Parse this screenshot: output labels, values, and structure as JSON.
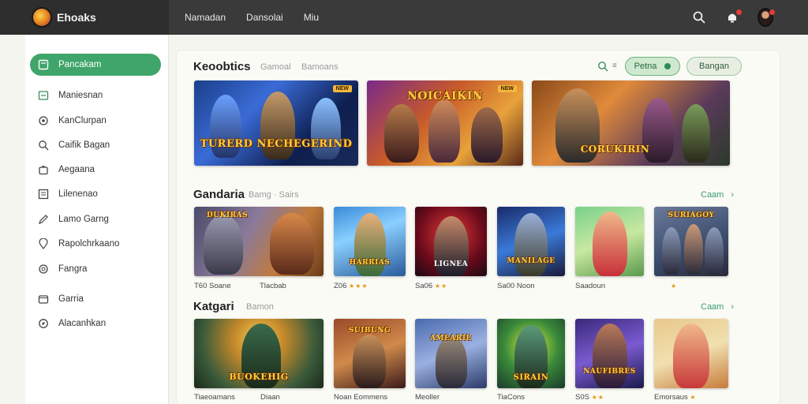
{
  "header": {
    "brand": "Ehoaks",
    "nav": [
      "Namadan",
      "Dansolai",
      "Miu"
    ]
  },
  "sidebar": {
    "items": [
      {
        "label": "Pancakam",
        "icon": "square-icon",
        "active": true
      },
      {
        "label": "Maniesnan",
        "icon": "image-icon",
        "active": false
      },
      {
        "label": "KanClurpan",
        "icon": "gear-icon",
        "active": false
      },
      {
        "label": "Caifik Bagan",
        "icon": "search-icon",
        "active": false
      },
      {
        "label": "Aegaana",
        "icon": "bag-icon",
        "active": false
      },
      {
        "label": "Lilenenao",
        "icon": "list-icon",
        "active": false
      },
      {
        "label": "Lamo Garng",
        "icon": "pencil-icon",
        "active": false
      },
      {
        "label": "Rapolchrkaano",
        "icon": "location-icon",
        "active": false
      },
      {
        "label": "Fangra",
        "icon": "settings-icon",
        "active": false
      },
      {
        "label": "Garria",
        "icon": "folder-icon",
        "active": false
      },
      {
        "label": "Alacanhkan",
        "icon": "compass-icon",
        "active": false
      }
    ]
  },
  "featured": {
    "title": "Keoobtics",
    "tabs": [
      "Gamoal",
      "Bamoans"
    ],
    "search_hint": "≡",
    "filter_chip": "Petna",
    "action_chip": "Bangan",
    "cards": [
      {
        "title": "TURERD NECHEGERIND",
        "tag": "NEW"
      },
      {
        "title": "NOICAIKIN",
        "tag": "NEW"
      },
      {
        "title": "CORUKIRIN",
        "tag": ""
      }
    ]
  },
  "section_two": {
    "title": "Gandaria",
    "sub": "Bamg · Sairs",
    "link": "Caam",
    "items": [
      {
        "title": "DUKIRAS",
        "caption": "T60 Soane",
        "stars": ""
      },
      {
        "title": "HARRIAS",
        "caption": "Z06",
        "stars": "★★★"
      },
      {
        "title": "LIGNEA",
        "caption": "Sa06",
        "stars": "★★"
      },
      {
        "title": "MANILAGE",
        "caption": "Sa00 Noon",
        "stars": ""
      },
      {
        "title": "",
        "caption": "Saadoun",
        "stars": ""
      },
      {
        "title": "SURIAGOY",
        "caption": "",
        "stars": "★"
      }
    ]
  },
  "section_three": {
    "title": "Katgari",
    "sub": "Bamon",
    "link": "Caam",
    "items": [
      {
        "title": "BUOKEHIG",
        "caption": "Tiaeoamans",
        "stars": ""
      },
      {
        "title": "SUIBUNG",
        "caption": "Noan Eommens",
        "stars": ""
      },
      {
        "title": "AMEARIE",
        "caption": "Meoller",
        "stars": ""
      },
      {
        "title": "SIRAIN",
        "caption": "TiaCons",
        "stars": ""
      },
      {
        "title": "NAUFIBRES",
        "caption": "S0S",
        "stars": "★★"
      },
      {
        "title": "",
        "caption": "Emorsaus",
        "stars": "★"
      }
    ]
  },
  "colors": {
    "accent_green": "#3fa56a",
    "topbar": "#3a3a3a",
    "star": "#e29a17"
  }
}
